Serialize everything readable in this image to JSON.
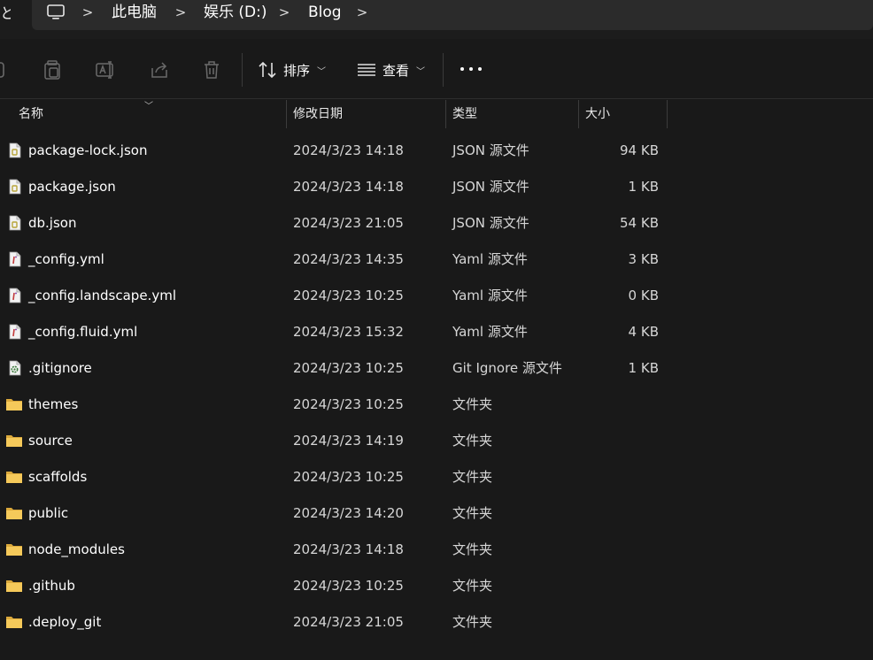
{
  "address_bar": {
    "left_glyph": "と",
    "crumbs": [
      "此电脑",
      "娱乐 (D:)",
      "Blog"
    ],
    "separator": ">",
    "icon": "computer-icon"
  },
  "toolbar": {
    "sort_label": "排序",
    "view_label": "查看",
    "icons": [
      "copy-icon",
      "paste-icon",
      "rename-icon",
      "share-icon",
      "delete-icon",
      "sort-icon",
      "view-icon",
      "more-icon"
    ]
  },
  "columns": [
    "名称",
    "修改日期",
    "类型",
    "大小"
  ],
  "files": [
    {
      "name": "package-lock.json",
      "date": "2024/3/23 14:18",
      "type": "JSON 源文件",
      "size": "94 KB",
      "icon": "json-file-icon"
    },
    {
      "name": "package.json",
      "date": "2024/3/23 14:18",
      "type": "JSON 源文件",
      "size": "1 KB",
      "icon": "json-file-icon"
    },
    {
      "name": "db.json",
      "date": "2024/3/23 21:05",
      "type": "JSON 源文件",
      "size": "54 KB",
      "icon": "json-file-icon"
    },
    {
      "name": "_config.yml",
      "date": "2024/3/23 14:35",
      "type": "Yaml 源文件",
      "size": "3 KB",
      "icon": "yaml-file-icon"
    },
    {
      "name": "_config.landscape.yml",
      "date": "2024/3/23 10:25",
      "type": "Yaml 源文件",
      "size": "0 KB",
      "icon": "yaml-file-icon"
    },
    {
      "name": "_config.fluid.yml",
      "date": "2024/3/23 15:32",
      "type": "Yaml 源文件",
      "size": "4 KB",
      "icon": "yaml-file-icon"
    },
    {
      "name": ".gitignore",
      "date": "2024/3/23 10:25",
      "type": "Git Ignore 源文件",
      "size": "1 KB",
      "icon": "gear-file-icon"
    },
    {
      "name": "themes",
      "date": "2024/3/23 10:25",
      "type": "文件夹",
      "size": "",
      "icon": "folder-icon"
    },
    {
      "name": "source",
      "date": "2024/3/23 14:19",
      "type": "文件夹",
      "size": "",
      "icon": "folder-icon"
    },
    {
      "name": "scaffolds",
      "date": "2024/3/23 10:25",
      "type": "文件夹",
      "size": "",
      "icon": "folder-icon"
    },
    {
      "name": "public",
      "date": "2024/3/23 14:20",
      "type": "文件夹",
      "size": "",
      "icon": "folder-icon"
    },
    {
      "name": "node_modules",
      "date": "2024/3/23 14:18",
      "type": "文件夹",
      "size": "",
      "icon": "folder-icon"
    },
    {
      "name": ".github",
      "date": "2024/3/23 10:25",
      "type": "文件夹",
      "size": "",
      "icon": "folder-icon"
    },
    {
      "name": ".deploy_git",
      "date": "2024/3/23 21:05",
      "type": "文件夹",
      "size": "",
      "icon": "folder-icon"
    }
  ],
  "colors": {
    "background": "#191919",
    "address_box": "#2b2b2b",
    "folder": "#f0c454",
    "json_accent": "#c8b54a",
    "yaml_accent": "#c23a3a"
  }
}
